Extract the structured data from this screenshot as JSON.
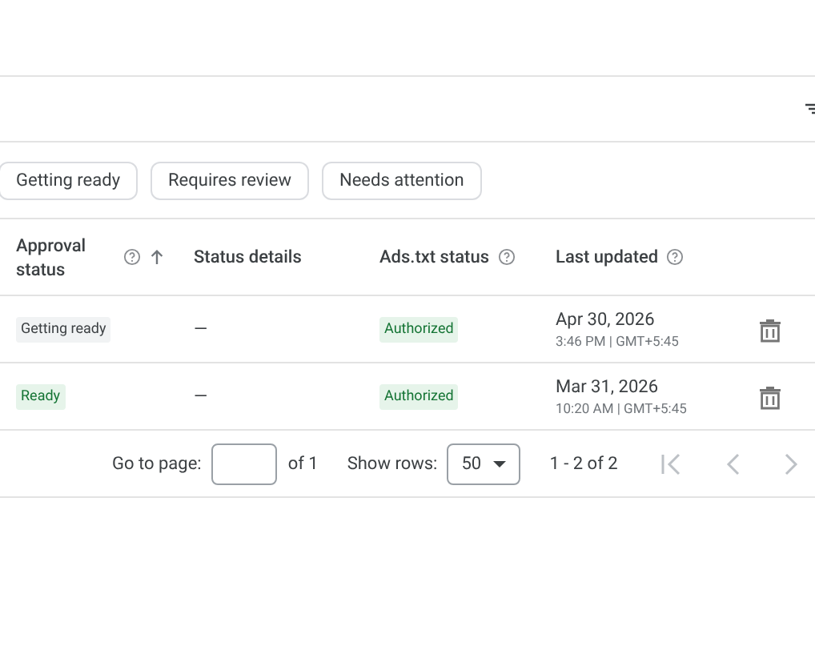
{
  "filter_chips": [
    {
      "label": "Getting ready"
    },
    {
      "label": "Requires review"
    },
    {
      "label": "Needs attention"
    }
  ],
  "table": {
    "columns": [
      {
        "label": "Approval status",
        "help": true,
        "sorted": true
      },
      {
        "label": "Status details",
        "help": false,
        "sorted": false
      },
      {
        "label": "Ads.txt status",
        "help": true,
        "sorted": false
      },
      {
        "label": "Last updated",
        "help": true,
        "sorted": false
      }
    ],
    "rows": [
      {
        "approval_status": {
          "text": "Getting ready",
          "kind": "neutral"
        },
        "status_details": "—",
        "ads_txt_status": {
          "text": "Authorized",
          "kind": "success"
        },
        "last_updated": {
          "date": "Apr 30, 2026",
          "time": "3:46 PM | GMT+5:45"
        }
      },
      {
        "approval_status": {
          "text": "Ready",
          "kind": "success"
        },
        "status_details": "—",
        "ads_txt_status": {
          "text": "Authorized",
          "kind": "success"
        },
        "last_updated": {
          "date": "Mar 31, 2026",
          "time": "10:20 AM | GMT+5:45"
        }
      }
    ]
  },
  "pagination": {
    "go_to_label": "Go to page:",
    "of_pages": "of 1",
    "show_rows_label": "Show rows:",
    "rows_value": "50",
    "range": "1 - 2 of 2"
  }
}
